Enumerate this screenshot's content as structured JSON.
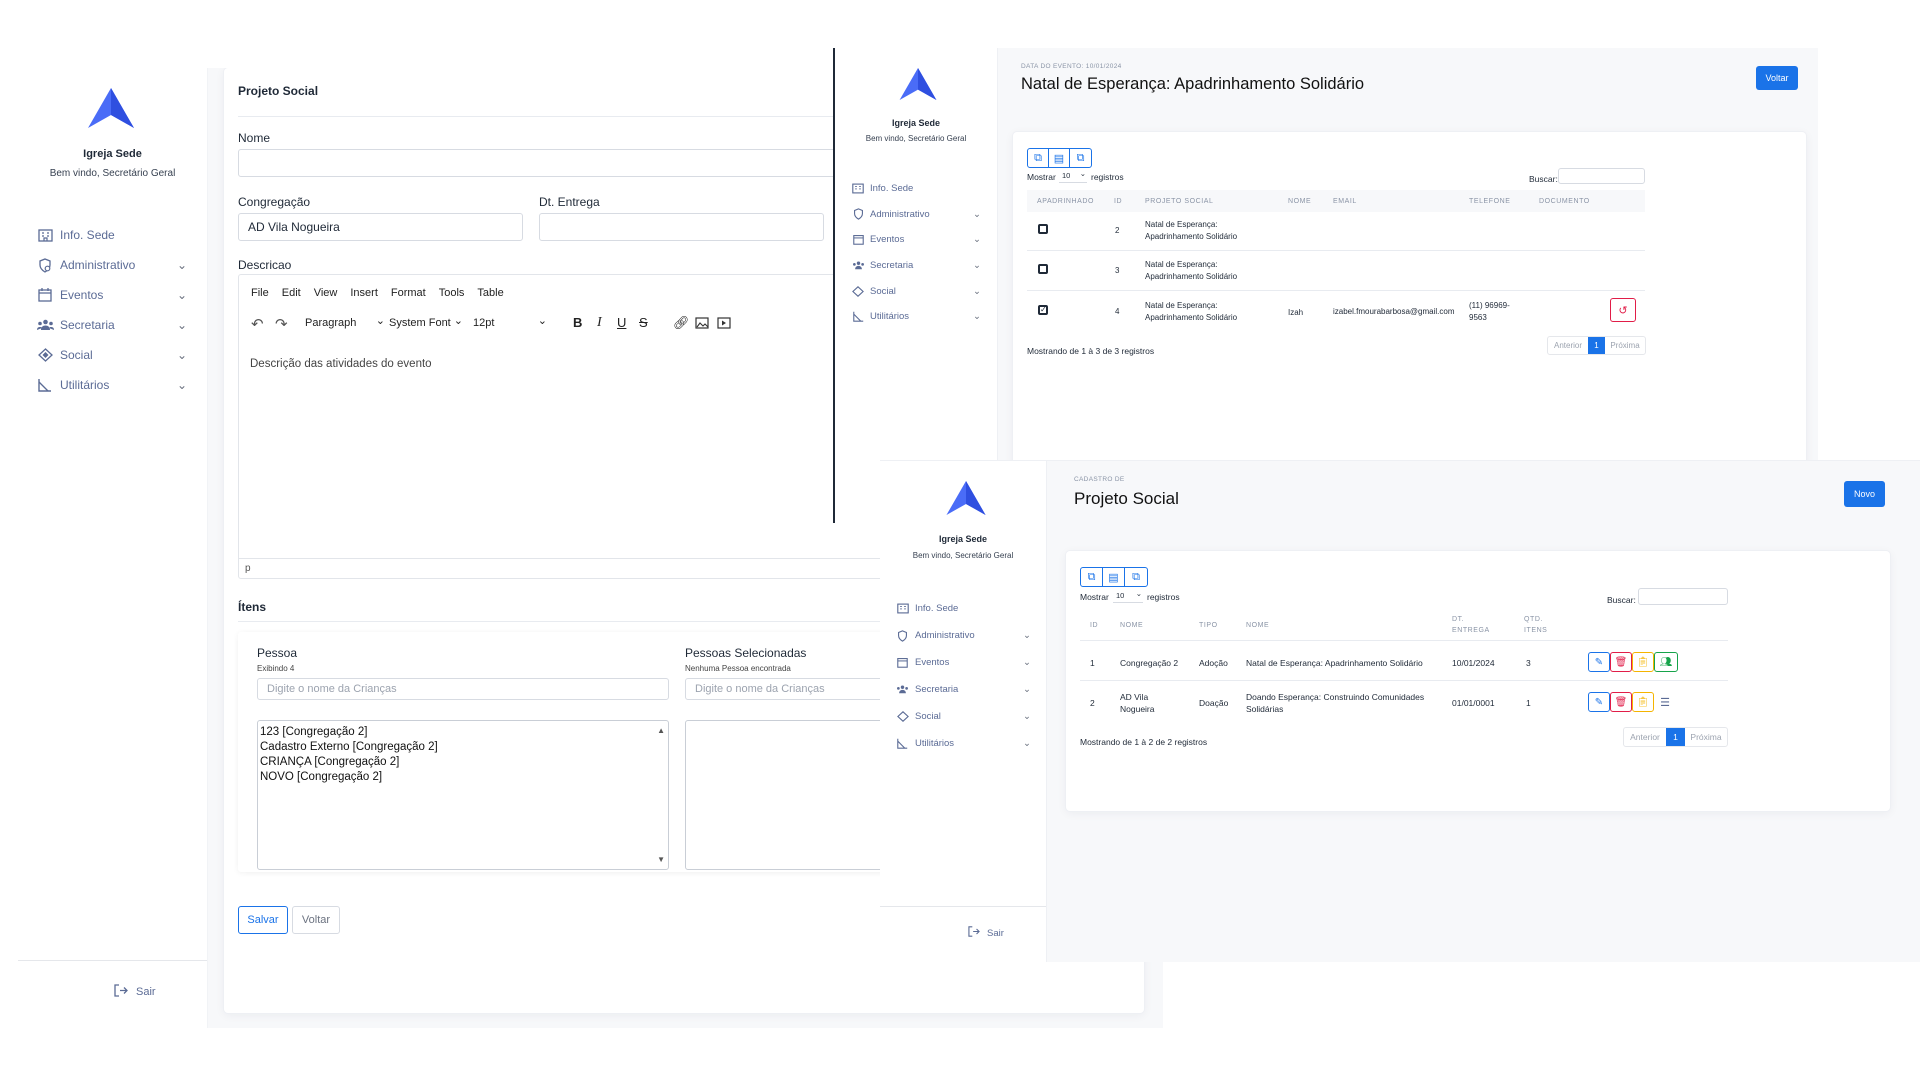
{
  "win1": {
    "sidebar": {
      "church": "Igreja Sede",
      "welcome": "Bem vindo, Secretário Geral",
      "items": [
        {
          "label": "Info. Sede",
          "icon": "building-icon",
          "chevron": false
        },
        {
          "label": "Administrativo",
          "icon": "shield-icon",
          "chevron": true
        },
        {
          "label": "Eventos",
          "icon": "calendar-icon",
          "chevron": true
        },
        {
          "label": "Secretaria",
          "icon": "users-icon",
          "chevron": true
        },
        {
          "label": "Social",
          "icon": "diamond-icon",
          "chevron": true
        },
        {
          "label": "Utilitários",
          "icon": "ruler-icon",
          "chevron": true
        }
      ],
      "logout": "Sair"
    },
    "form": {
      "section_title": "Projeto Social",
      "nome_label": "Nome",
      "nome_value": "",
      "congregacao_label": "Congregação",
      "congregacao_value": "AD Vila Nogueira",
      "dt_entrega_label": "Dt. Entrega",
      "dt_entrega_value": "",
      "descricao_label": "Descricao",
      "editor_menu": [
        "File",
        "Edit",
        "View",
        "Insert",
        "Format",
        "Tools",
        "Table"
      ],
      "block_format": "Paragraph",
      "font_family": "System Font",
      "font_size": "12pt",
      "editor_content": "Descrição das atividades do evento",
      "editor_path": "p",
      "itens_title": "Ítens",
      "pessoa_label": "Pessoa",
      "pessoa_count": "Exibindo 4",
      "pessoa_placeholder": "Digite o nome da Crianças",
      "pessoa_options": [
        "123 [Congregação 2]",
        "Cadastro Externo [Congregação 2]",
        "CRIANÇA [Congregação 2]",
        "NOVO [Congregação 2]"
      ],
      "selecionadas_label": "Pessoas Selecionadas",
      "selecionadas_count": "Nenhuma Pessoa encontrada",
      "selecionadas_placeholder": "Digite o nome da Crianças",
      "save": "Salvar",
      "back": "Voltar"
    }
  },
  "win2": {
    "sidebar": {
      "church": "Igreja Sede",
      "welcome": "Bem vindo, Secretário Geral",
      "items": [
        {
          "label": "Info. Sede",
          "icon": "building-icon",
          "chevron": false
        },
        {
          "label": "Administrativo",
          "icon": "shield-icon",
          "chevron": true
        },
        {
          "label": "Eventos",
          "icon": "calendar-icon",
          "chevron": true
        },
        {
          "label": "Secretaria",
          "icon": "users-icon",
          "chevron": true
        },
        {
          "label": "Social",
          "icon": "diamond-icon",
          "chevron": true
        },
        {
          "label": "Utilitários",
          "icon": "ruler-icon",
          "chevron": true
        }
      ]
    },
    "eyebrow": "DATA DO EVENTO: 10/01/2024",
    "title": "Natal de Esperança: Apadrinhamento Solidário",
    "back": "Voltar",
    "show_label": "Mostrar",
    "show_value": "10",
    "records_label": "registros",
    "search_label": "Buscar:",
    "headers": [
      "APADRINHADO",
      "ID",
      "PROJETO SOCIAL",
      "NOME",
      "EMAIL",
      "TELEFONE",
      "DOCUMENTO"
    ],
    "rows": [
      {
        "checked": false,
        "id": "2",
        "projeto1": "Natal de Esperança:",
        "projeto2": "Apadrinhamento Solidário",
        "nome": "",
        "email": "",
        "tel1": "",
        "tel2": "",
        "action": false
      },
      {
        "checked": false,
        "id": "3",
        "projeto1": "Natal de Esperança:",
        "projeto2": "Apadrinhamento Solidário",
        "nome": "",
        "email": "",
        "tel1": "",
        "tel2": "",
        "action": false
      },
      {
        "checked": true,
        "id": "4",
        "projeto1": "Natal de Esperança:",
        "projeto2": "Apadrinhamento Solidário",
        "nome": "Izah",
        "email": "izabel.fmourabarbosa@gmail.com",
        "tel1": "(11) 96969-",
        "tel2": "9563",
        "action": true
      }
    ],
    "summary": "Mostrando de 1 à 3 de 3 registros",
    "pager": {
      "prev": "Anterior",
      "page": "1",
      "next": "Próxima"
    }
  },
  "win3": {
    "sidebar": {
      "church": "Igreja Sede",
      "welcome": "Bem vindo, Secretário Geral",
      "items": [
        {
          "label": "Info. Sede",
          "icon": "building-icon",
          "chevron": false
        },
        {
          "label": "Administrativo",
          "icon": "shield-icon",
          "chevron": true
        },
        {
          "label": "Eventos",
          "icon": "calendar-icon",
          "chevron": true
        },
        {
          "label": "Secretaria",
          "icon": "users-icon",
          "chevron": true
        },
        {
          "label": "Social",
          "icon": "diamond-icon",
          "chevron": true
        },
        {
          "label": "Utilitários",
          "icon": "ruler-icon",
          "chevron": true
        }
      ],
      "logout": "Sair"
    },
    "eyebrow": "CADASTRO DE",
    "title": "Projeto Social",
    "new": "Novo",
    "show_label": "Mostrar",
    "show_value": "10",
    "records_label": "registros",
    "search_label": "Buscar:",
    "headers": [
      "ID",
      "NOME",
      "TIPO",
      "NOME",
      "DT.",
      "ENTREGA",
      "QTD.",
      "ITENS"
    ],
    "rows": [
      {
        "id": "1",
        "nome1": "Congregação 2",
        "nome2": "",
        "tipo": "Adoção",
        "projeto1": "Natal de Esperança: Apadrinhamento Solidário",
        "projeto2": "",
        "data": "10/01/2024",
        "qtd": "3"
      },
      {
        "id": "2",
        "nome1": "AD Vila",
        "nome2": "Nogueira",
        "tipo": "Doação",
        "projeto1": "Doando Esperança: Construindo Comunidades",
        "projeto2": "Solidárias",
        "data": "01/01/0001",
        "qtd": "1"
      }
    ],
    "summary": "Mostrando de 1 à 2 de 2 registros",
    "pager": {
      "prev": "Anterior",
      "page": "1",
      "next": "Próxima"
    }
  },
  "colors": {
    "primary": "#1a73e8",
    "danger": "#e11d48",
    "warning": "#f5b400",
    "success": "#16a34a",
    "logo": "#4a6cf7"
  }
}
